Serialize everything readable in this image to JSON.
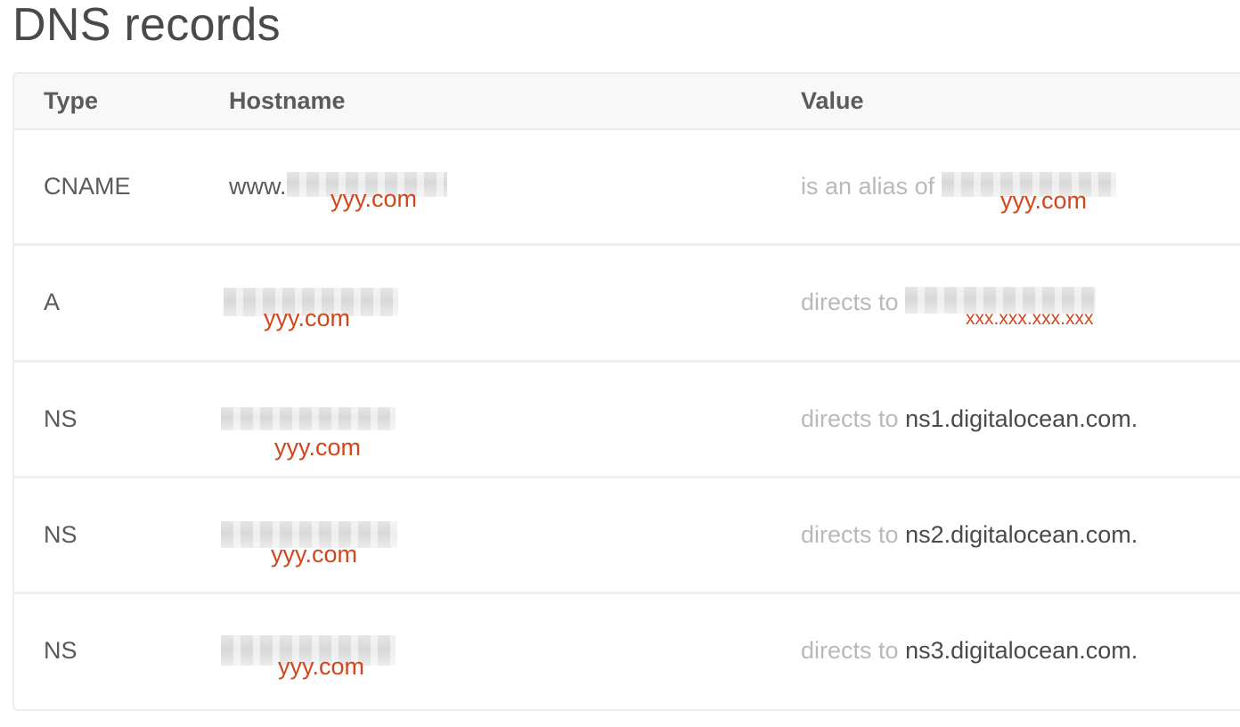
{
  "page": {
    "title": "DNS records"
  },
  "table": {
    "headers": {
      "type": "Type",
      "hostname": "Hostname",
      "value": "Value"
    },
    "rows": [
      {
        "type": "CNAME",
        "host_prefix": "www.",
        "host_overlay": "yyy.com",
        "value_prefix": "is an alias of",
        "value_main": "",
        "value_overlay": "yyy.com"
      },
      {
        "type": "A",
        "host_prefix": "",
        "host_overlay": "yyy.com",
        "value_prefix": "directs to",
        "value_main": "",
        "value_overlay": "xxx.xxx.xxx.xxx"
      },
      {
        "type": "NS",
        "host_prefix": "",
        "host_overlay": "yyy.com",
        "value_prefix": "directs to",
        "value_main": "ns1.digitalocean.com.",
        "value_overlay": ""
      },
      {
        "type": "NS",
        "host_prefix": "",
        "host_overlay": "yyy.com",
        "value_prefix": "directs to",
        "value_main": "ns2.digitalocean.com.",
        "value_overlay": ""
      },
      {
        "type": "NS",
        "host_prefix": "",
        "host_overlay": "yyy.com",
        "value_prefix": "directs to",
        "value_main": "ns3.digitalocean.com.",
        "value_overlay": ""
      }
    ]
  },
  "colors": {
    "overlay_text": "#d2461c",
    "muted_text": "#b9b9b9",
    "body_text": "#5a5a5a",
    "header_bg": "#f8f8f8",
    "border": "#ececec"
  }
}
